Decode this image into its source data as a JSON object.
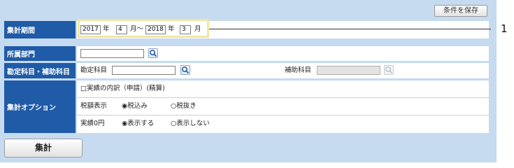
{
  "header": {
    "save_conditions_label": "条件を保存"
  },
  "rows": {
    "period": {
      "label": "集計期間",
      "start_year": "2017",
      "year_unit_1": "年",
      "start_month": "4",
      "month_range_sep": "月〜",
      "end_year": "2018",
      "year_unit_2": "年",
      "end_month": "3",
      "month_unit": "月"
    },
    "department": {
      "label": "所属部門",
      "value": ""
    },
    "accounts": {
      "label": "勘定科目・補助科目",
      "account_label": "勘定科目",
      "account_value": "",
      "sub_account_label": "補助科目",
      "sub_account_value": ""
    },
    "options": {
      "label": "集計オプション",
      "breakdown_checkbox_label": "□実績の内訳（申請）(精算)",
      "tax_label": "税額表示",
      "tax_included_label": "◉税込み",
      "tax_excluded_label": "○税抜き",
      "zero_label": "実績0円",
      "show_label": "◉表示する",
      "hide_label": "○表示しない"
    }
  },
  "callout": {
    "number": "1"
  },
  "footer": {
    "run_label": "集計"
  }
}
